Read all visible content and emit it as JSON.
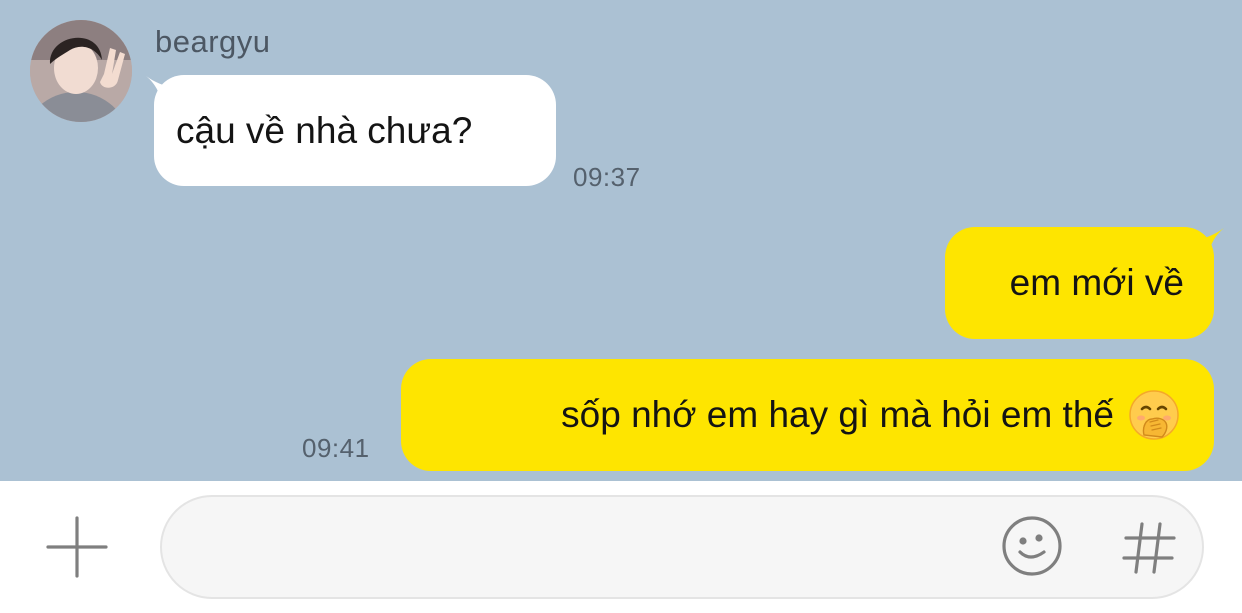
{
  "conversation": {
    "sender_name": "beargyu",
    "messages": [
      {
        "direction": "incoming",
        "text": "cậu về nhà chưa?",
        "time": "09:37"
      },
      {
        "direction": "outgoing",
        "text": "em mới về",
        "time": ""
      },
      {
        "direction": "outgoing",
        "text": "sốp nhớ em hay gì mà hỏi em thế",
        "emoji": "face-with-hand-over-mouth-emoji",
        "time": "09:41"
      }
    ]
  },
  "composer": {
    "input_value": "",
    "attach_icon": "plus-icon",
    "emoji_icon": "smiley-icon",
    "hashtag_icon": "hashtag-icon"
  },
  "colors": {
    "chat_background": "#abc1d3",
    "incoming_bubble": "#ffffff",
    "outgoing_bubble": "#fee500",
    "composer_background": "#ffffff"
  }
}
